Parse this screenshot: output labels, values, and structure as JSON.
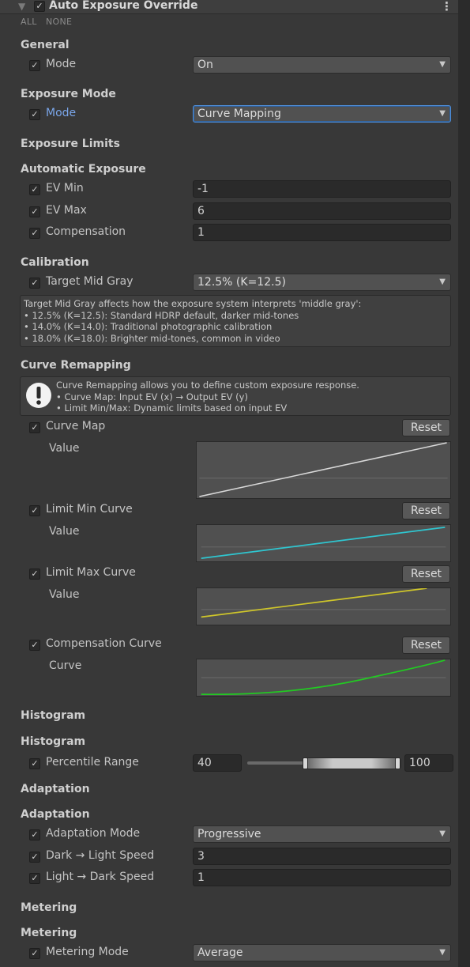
{
  "header": {
    "title": "Auto Exposure Override",
    "all_label": "ALL",
    "none_label": "NONE",
    "arrow_glyph": "▼",
    "check_glyph": "✓",
    "menu_glyph": "⋮"
  },
  "general": {
    "section": "General",
    "mode_label": "Mode",
    "mode_value": "On"
  },
  "exposure_mode": {
    "section": "Exposure Mode",
    "mode_label": "Mode",
    "mode_value": "Curve Mapping"
  },
  "exposure_limits": {
    "section": "Exposure Limits"
  },
  "automatic_exposure": {
    "section": "Automatic Exposure",
    "ev_min_label": "EV Min",
    "ev_min_value": "-1",
    "ev_max_label": "EV Max",
    "ev_max_value": "6",
    "compensation_label": "Compensation",
    "compensation_value": "1"
  },
  "calibration": {
    "section": "Calibration",
    "target_label": "Target Mid Gray",
    "target_value": "12.5% (K=12.5)",
    "help_lines": [
      "Target Mid Gray affects how the exposure system interprets 'middle gray':",
      "• 12.5% (K=12.5): Standard HDRP default, darker mid-tones",
      "• 14.0% (K=14.0): Traditional photographic calibration",
      "• 18.0% (K=18.0): Brighter mid-tones, common in video"
    ]
  },
  "curve_remapping": {
    "section": "Curve Remapping",
    "info_lines": [
      "Curve Remapping allows you to define custom exposure response.",
      "• Curve Map: Input EV (x) → Output EV (y)",
      "• Limit Min/Max: Dynamic limits based on input EV"
    ],
    "reset_label": "Reset",
    "curve_map_label": "Curve Map",
    "curve_map_sub": "Value",
    "limit_min_label": "Limit Min Curve",
    "limit_min_sub": "Value",
    "limit_max_label": "Limit Max Curve",
    "limit_max_sub": "Value",
    "comp_curve_label": "Compensation Curve",
    "comp_curve_sub": "Curve",
    "colors": {
      "curve_map": "#d8d8d8",
      "limit_min": "#2fc6d0",
      "limit_max": "#cfc62a",
      "compensation": "#22c922"
    }
  },
  "histogram": {
    "section": "Histogram",
    "subsection": "Histogram",
    "percentile_label": "Percentile Range",
    "min_value": "40",
    "max_value": "100"
  },
  "adaptation": {
    "section": "Adaptation",
    "subsection": "Adaptation",
    "mode_label": "Adaptation Mode",
    "mode_value": "Progressive",
    "dark_light_label": "Dark → Light Speed",
    "dark_light_value": "3",
    "light_dark_label": "Light → Dark Speed",
    "light_dark_value": "1"
  },
  "metering": {
    "section": "Metering",
    "subsection": "Metering",
    "mode_label": "Metering Mode",
    "mode_value": "Average"
  }
}
